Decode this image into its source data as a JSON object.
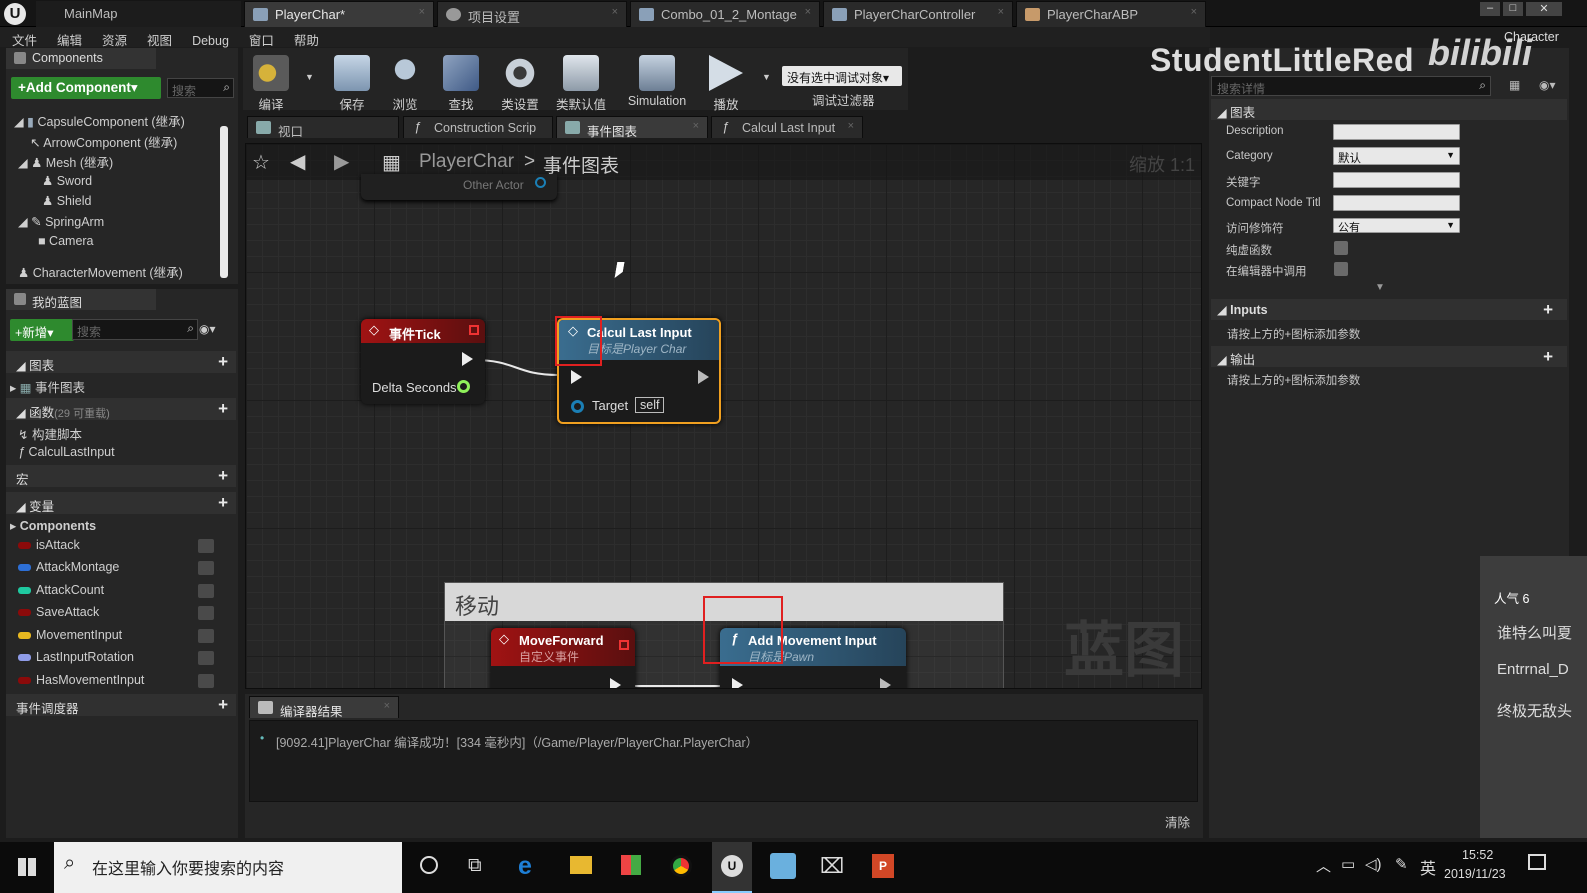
{
  "titlebar": {
    "tabs": [
      {
        "label": "MainMap"
      },
      {
        "label": "PlayerChar*"
      },
      {
        "label": "项目设置"
      },
      {
        "label": "Combo_01_2_Montage"
      },
      {
        "label": "PlayerCharController"
      },
      {
        "label": "PlayerCharABP"
      }
    ],
    "right_label": "Character"
  },
  "menu": [
    "文件",
    "编辑",
    "资源",
    "视图",
    "Debug",
    "窗口",
    "帮助"
  ],
  "components": {
    "tab_label": "Components",
    "add_button": "+Add Component▾",
    "search_placeholder": "搜索",
    "tree": [
      "CapsuleComponent (继承)",
      "ArrowComponent (继承)",
      "Mesh (继承)",
      "Sword",
      "Shield",
      "SpringArm",
      "Camera",
      "CharacterMovement (继承)"
    ]
  },
  "myblueprint": {
    "tab_label": "我的蓝图",
    "new_button": "+新增▾",
    "search_placeholder": "搜索",
    "graphs_label": "图表",
    "event_graph_label": "事件图表",
    "functions_label": "函数",
    "functions_count": "(29 可重载)",
    "function_items": [
      "构建脚本",
      "CalculLastInput"
    ],
    "macros_label": "宏",
    "variables_label": "变量",
    "components_label": "Components",
    "variables": [
      {
        "name": "isAttack",
        "color": "#8b0a0a"
      },
      {
        "name": "AttackMontage",
        "color": "#2d6fd6"
      },
      {
        "name": "AttackCount",
        "color": "#1fc9a0"
      },
      {
        "name": "SaveAttack",
        "color": "#8b0a0a"
      },
      {
        "name": "MovementInput",
        "color": "#e8b820"
      },
      {
        "name": "LastInputRotation",
        "color": "#8f9ce8"
      },
      {
        "name": "HasMovementInput",
        "color": "#8b0a0a"
      }
    ],
    "dispatchers_label": "事件调度器"
  },
  "toolbar": {
    "buttons": [
      "编译",
      "保存",
      "浏览",
      "查找",
      "类设置",
      "类默认值",
      "Simulation",
      "播放"
    ],
    "debug_select": "没有选中调试对象▾",
    "debug_filter": "调试过滤器"
  },
  "editor_tabs": [
    "视口",
    "Construction Scrip",
    "事件图表",
    "Calcul Last Input"
  ],
  "breadcrumb": {
    "root": "PlayerChar",
    "sep": ">",
    "current": "事件图表",
    "zoom": "缩放 1:1"
  },
  "graph": {
    "faded_node_pin": "Other Actor",
    "event_tick": {
      "title": "事件Tick",
      "pin": "Delta Seconds"
    },
    "calcul_node": {
      "title": "Calcul Last Input",
      "subtitle": "目标是Player Char",
      "pin": "Target",
      "pin_value": "self"
    },
    "comment_title": "移动",
    "move_forward": {
      "title": "MoveForward",
      "subtitle": "自定义事件"
    },
    "add_movement": {
      "title": "Add Movement Input",
      "subtitle": "目标是Pawn"
    },
    "watermark": "蓝图"
  },
  "compiler": {
    "tab_label": "编译器结果",
    "message": "[9092.41]PlayerChar 编译成功！[334 毫秒内]（/Game/Player/PlayerChar.PlayerChar）",
    "clear_button": "清除"
  },
  "details": {
    "search_placeholder": "搜索详情",
    "graph_section": "图表",
    "rows": [
      {
        "label": "Description",
        "value": ""
      },
      {
        "label": "Category",
        "value": "默认"
      },
      {
        "label": "关键字",
        "value": ""
      },
      {
        "label": "Compact Node Titl",
        "value": ""
      },
      {
        "label": "访问修饰符",
        "value": "公有"
      },
      {
        "label": "纯虚函数",
        "value": ""
      },
      {
        "label": "在编辑器中调用",
        "value": ""
      }
    ],
    "inputs_label": "Inputs",
    "inputs_hint": "请按上方的+图标添加参数",
    "outputs_label": "输出",
    "outputs_hint": "请按上方的+图标添加参数"
  },
  "overlay": {
    "brand": "StudentLittleRed",
    "site": "bilibili",
    "popularity": "人气 6",
    "chat": [
      "谁特么叫夏",
      "Entrrnal_D",
      "终极无敌头"
    ]
  },
  "taskbar": {
    "search_placeholder": "在这里输入你要搜索的内容",
    "ime": "英",
    "time": "15:52",
    "date": "2019/11/23"
  }
}
